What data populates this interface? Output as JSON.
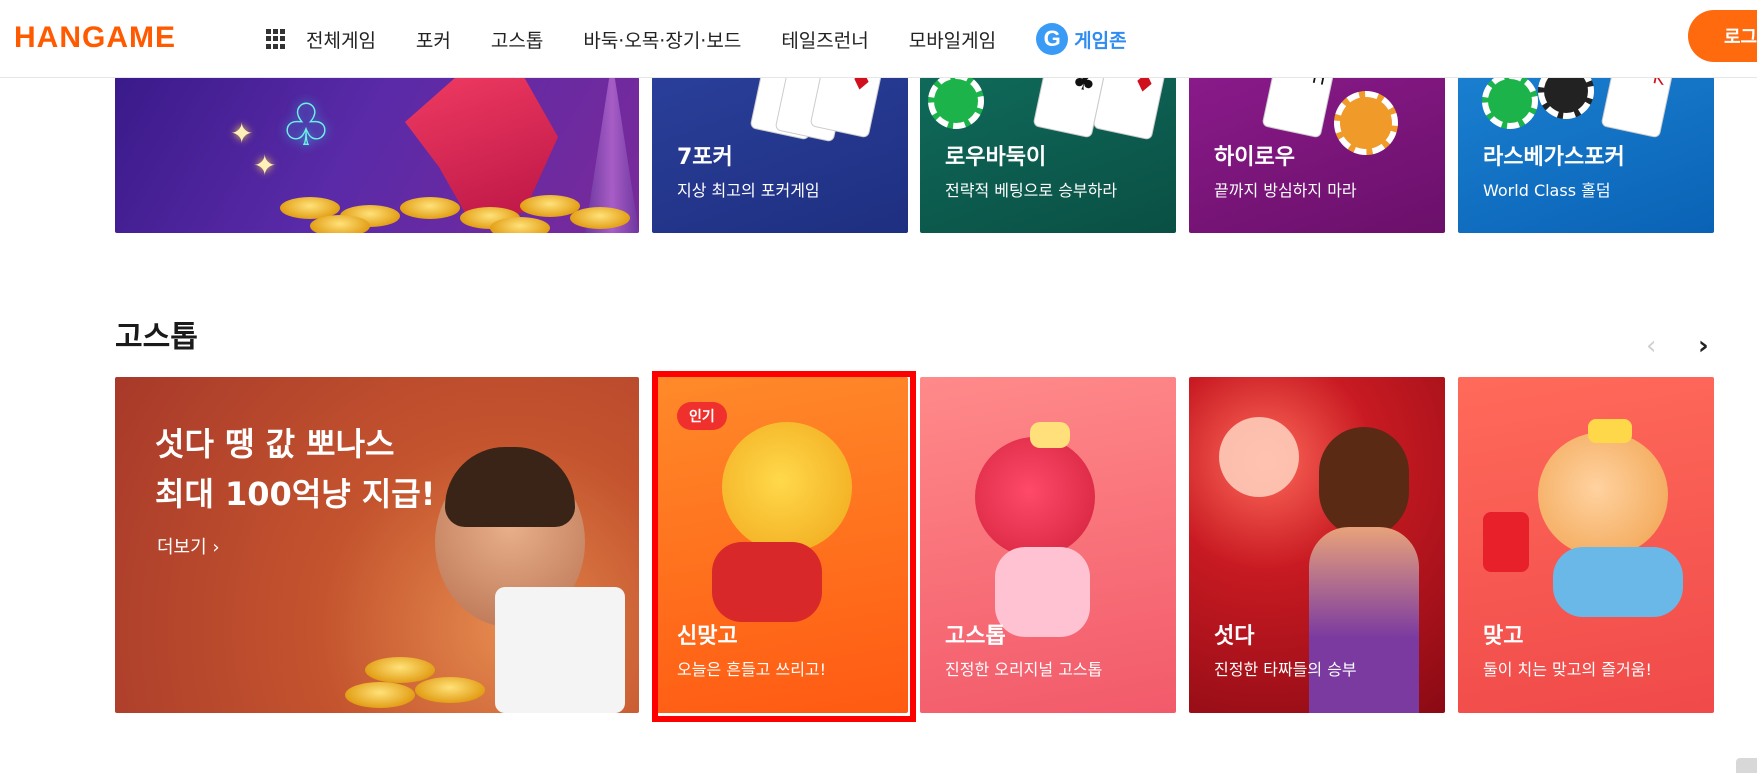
{
  "header": {
    "logo": "HANGAME",
    "nav_icon": "grid-icon",
    "nav": [
      "전체게임",
      "포커",
      "고스톱",
      "바둑·오목·장기·보드",
      "테일즈런너",
      "모바일게임"
    ],
    "gamezone_badge": "G",
    "gamezone": "게임존",
    "login": "로그인"
  },
  "top_row": [
    {
      "title": "7포커",
      "subtitle": "지상 최고의 포커게임"
    },
    {
      "title": "로우바둑이",
      "subtitle": "전략적 베팅으로 승부하라"
    },
    {
      "title": "하이로우",
      "subtitle": "끝까지 방심하지 마라"
    },
    {
      "title": "라스베가스포커",
      "subtitle": "World Class 홀덤"
    }
  ],
  "section": {
    "title": "고스톱",
    "prev_arrow": "‹",
    "next_arrow": "›"
  },
  "promo": {
    "line1": "섯다 땡 값 뽀나스",
    "line2": "최대 100억냥 지급!",
    "more": "더보기 ›"
  },
  "cards": [
    {
      "title": "신맞고",
      "subtitle": "오늘은 흔들고 쓰리고!",
      "badge": "인기"
    },
    {
      "title": "고스톱",
      "subtitle": "진정한 오리지널 고스톱"
    },
    {
      "title": "섯다",
      "subtitle": "진정한 타짜들의 승부"
    },
    {
      "title": "맞고",
      "subtitle": "둘이 치는 맞고의 즐거움!"
    }
  ],
  "colors": {
    "brand": "#ff5a00",
    "gamezone": "#2f8cf0",
    "highlight": "#ff0000"
  }
}
